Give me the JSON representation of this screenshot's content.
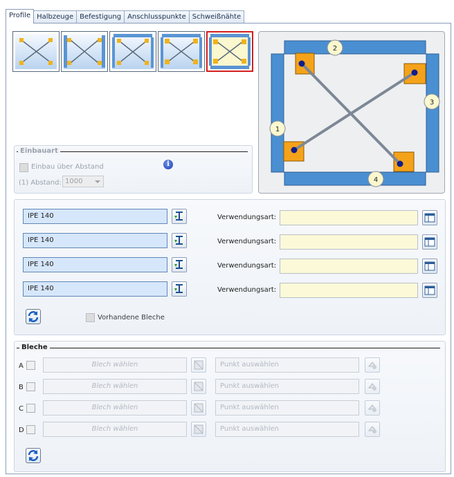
{
  "tabs": [
    {
      "label": "Profile"
    },
    {
      "label": "Halbzeuge"
    },
    {
      "label": "Befestigung"
    },
    {
      "label": "Anschlusspunkte"
    },
    {
      "label": "Schweißnähte"
    }
  ],
  "einbauart": {
    "title": "Einbauart",
    "checkbox_label": "Einbau über Abstand",
    "abstand_label": "(1) Abstand:",
    "abstand_value": "1000"
  },
  "diagram": {
    "labels": [
      "1",
      "2",
      "3",
      "4"
    ]
  },
  "profiles": {
    "rows": [
      {
        "profile": "IPE 140",
        "usage_label": "Verwendungsart:",
        "usage_value": ""
      },
      {
        "profile": "IPE 140",
        "usage_label": "Verwendungsart:",
        "usage_value": ""
      },
      {
        "profile": "IPE 140",
        "usage_label": "Verwendungsart:",
        "usage_value": ""
      },
      {
        "profile": "IPE 140",
        "usage_label": "Verwendungsart:",
        "usage_value": ""
      }
    ],
    "existing_label": "Vorhandene Bleche"
  },
  "bleche": {
    "title": "Bleche",
    "rows": [
      {
        "letter": "A",
        "blech_placeholder": "Blech wählen",
        "punkt_placeholder": "Punkt auswählen"
      },
      {
        "letter": "B",
        "blech_placeholder": "Blech wählen",
        "punkt_placeholder": "Punkt auswählen"
      },
      {
        "letter": "C",
        "blech_placeholder": "Blech wählen",
        "punkt_placeholder": "Punkt auswählen"
      },
      {
        "letter": "D",
        "blech_placeholder": "Blech wählen",
        "punkt_placeholder": "Punkt auswählen"
      }
    ]
  },
  "colors": {
    "frame_blue": "#4a8fd1",
    "plate_orange": "#f5a21b",
    "selected_border": "#d21e1e",
    "profile_input_bg": "#d6e7fb",
    "usage_input_bg": "#fbf9d8"
  }
}
